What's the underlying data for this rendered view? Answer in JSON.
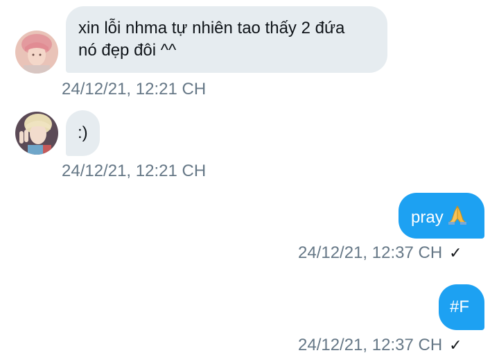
{
  "messages": [
    {
      "direction": "incoming",
      "text_line1": "xin lỗi nhma tự nhiên tao thấy 2 đứa",
      "text_line2": "nó đẹp đôi ^^",
      "timestamp": "24/12/21, 12:21 CH",
      "avatar": "pink-hair-person-avatar"
    },
    {
      "direction": "incoming",
      "text": ":)",
      "timestamp": "24/12/21, 12:21 CH",
      "avatar": "blond-hair-peace-sign-avatar"
    },
    {
      "direction": "outgoing",
      "text": "pray",
      "emoji": "folded-hands-icon",
      "timestamp": "24/12/21, 12:37 CH",
      "status": "✓"
    },
    {
      "direction": "outgoing",
      "text": "#F",
      "timestamp": "24/12/21, 12:37 CH",
      "status": "✓"
    }
  ],
  "colors": {
    "incoming_bubble": "#e6ecf0",
    "outgoing_bubble": "#1da1f2",
    "timestamp": "#657786"
  }
}
